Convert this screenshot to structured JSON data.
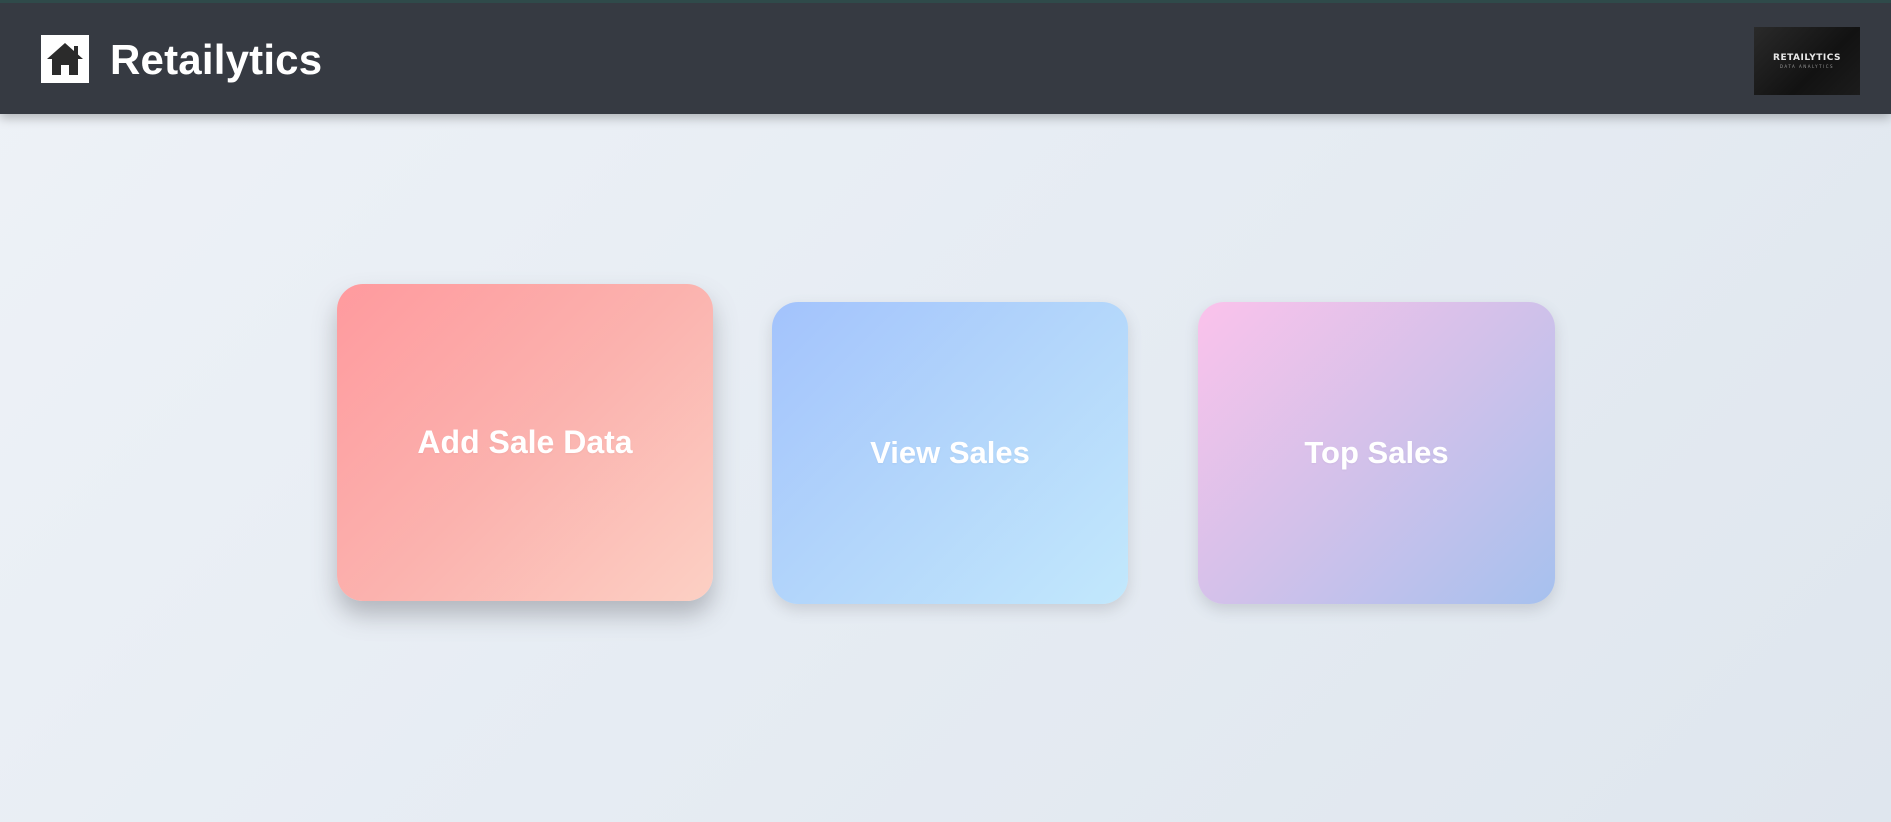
{
  "header": {
    "home_icon": "home-icon",
    "app_title": "Retailytics",
    "logo": {
      "main_text": "RETAILYTICS",
      "sub_text": "DATA ANALYTICS"
    }
  },
  "cards": [
    {
      "label": "Add Sale Data",
      "colors": [
        "#ff9a9e",
        "#fcd0c4"
      ]
    },
    {
      "label": "View Sales",
      "colors": [
        "#a3c3fc",
        "#c2e8fc"
      ]
    },
    {
      "label": "Top Sales",
      "colors": [
        "#fbc2eb",
        "#a6c1ee"
      ]
    }
  ],
  "colors": {
    "header_bg": "#363a42",
    "page_bg": "#e6ecf3",
    "text": "#ffffff"
  }
}
